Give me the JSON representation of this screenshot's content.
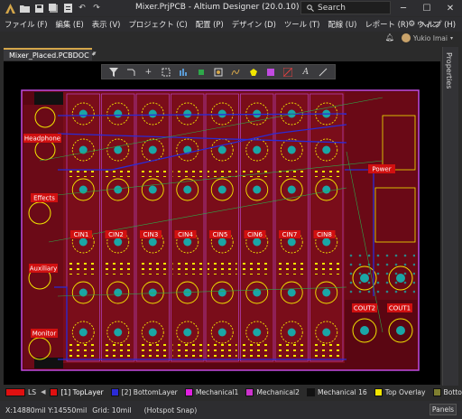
{
  "window": {
    "title": "Mixer.PrjPCB - Altium Designer (20.0.10)",
    "search_placeholder": "Search"
  },
  "menu": {
    "items": [
      "ファイル (F)",
      "編集 (E)",
      "表示 (V)",
      "プロジェクト (C)",
      "配置 (P)",
      "デザイン (D)",
      "ツール (T)",
      "配線 (U)",
      "レポート (R)",
      "ウィン"
    ],
    "help": "ヘルプ (H)",
    "user": "Yukio Imai"
  },
  "document": {
    "tab_label": "Mixer_Placed.PCBDOC",
    "modified_marker": "*"
  },
  "properties_panel": {
    "label": "Properties"
  },
  "active_bar": {
    "icons": [
      "filter-icon",
      "route-icon",
      "cross-icon",
      "select-rect-icon",
      "align-icon",
      "component-icon",
      "pad-icon",
      "interactive-route-icon",
      "polygon-icon",
      "drc-marker-icon",
      "dimension-icon",
      "text-icon",
      "line-icon"
    ]
  },
  "pcb": {
    "labels": {
      "headphone": "Headphone",
      "effects": "Effects",
      "auxiliary": "Auxiliary",
      "monitor": "Monitor",
      "power": "Power",
      "cin": [
        "CIN1",
        "CIN2",
        "CIN3",
        "CIN4",
        "CIN5",
        "CIN6",
        "CIN7",
        "CIN8"
      ],
      "cout2": "COUT2",
      "cout1": "COUT1"
    },
    "colors": {
      "board": "#7a0d1a",
      "board_dark": "#5a0612",
      "copper_bottom": "#2b2bd6",
      "pad_teal": "#1aa6a6",
      "silkscreen": "#f2e600",
      "outline": "#c14be0",
      "label_bg": "#d11010"
    }
  },
  "layers": {
    "ls": "LS",
    "items": [
      {
        "name": "[1] TopLayer",
        "color": "#e01010",
        "active": true
      },
      {
        "name": "[2] BottomLayer",
        "color": "#2b2bd6",
        "active": false
      },
      {
        "name": "Mechanical1",
        "color": "#e020e0",
        "active": false
      },
      {
        "name": "Mechanical2",
        "color": "#cc33cc",
        "active": false
      },
      {
        "name": "Mechanical 16",
        "color": "#111111",
        "active": false
      },
      {
        "name": "Top Overlay",
        "color": "#f2e600",
        "active": false
      },
      {
        "name": "Bottom",
        "color": "#7f7f30",
        "active": false
      }
    ]
  },
  "status": {
    "coords": "X:14880mil Y:14550mil",
    "grid": "Grid: 10mil",
    "snap": "(Hotspot Snap)",
    "panels_button": "Panels"
  }
}
